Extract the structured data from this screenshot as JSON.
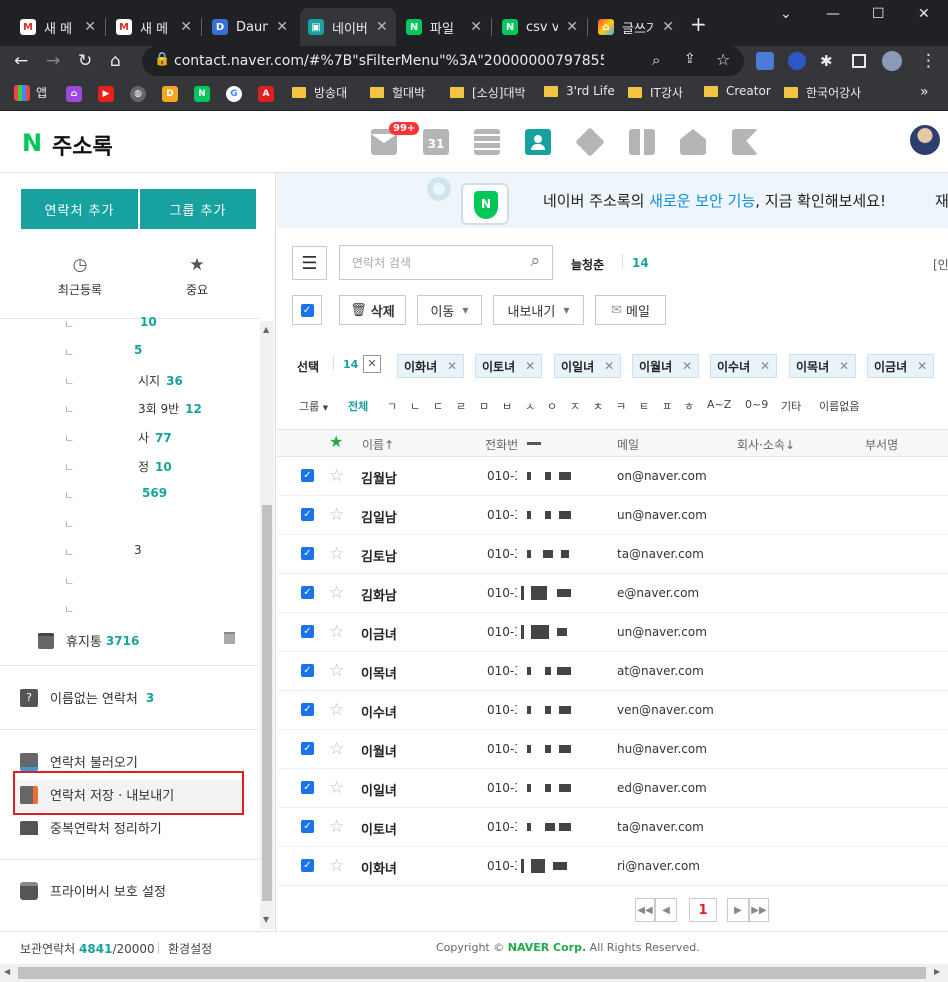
{
  "browser": {
    "tabs": [
      {
        "title": "새 메",
        "icon": "gmail-icon"
      },
      {
        "title": "새 메",
        "icon": "gmail-icon"
      },
      {
        "title": "Daum",
        "icon": "daum-icon"
      },
      {
        "title": "네이버",
        "icon": "naver-contact-icon"
      },
      {
        "title": "파일",
        "icon": "naver-icon"
      },
      {
        "title": "csv vo",
        "icon": "naver-icon"
      },
      {
        "title": "글쓰기",
        "icon": "blog-icon"
      }
    ],
    "url": "contact.naver.com/#%7B\"sFilterMenu\"%3A\"20000000797855\"%2C\"sGr...",
    "bookmarks": [
      "앱",
      "방송대",
      "헐대박",
      "[소싱]대박",
      "3'rd Life",
      "IT강사",
      "Creator",
      "한국어강사"
    ]
  },
  "app": {
    "logo_letter": "N",
    "title": "주소록",
    "mail_badge": "99+",
    "calendar_day": "31",
    "banner_text_pre": "네이버 주소록의 ",
    "banner_text_hl": "새로운 보안 기능",
    "banner_text_post": ", 지금 확인해보세요!",
    "banner_cut": "재"
  },
  "sidebar": {
    "add_contact": "연락처 추가",
    "add_group": "그룹 추가",
    "recent_label": "최근등록",
    "important_label": "중요",
    "tree": [
      {
        "label": "",
        "count": "10"
      },
      {
        "label": "",
        "count": "5"
      },
      {
        "label": "시지",
        "count": "36"
      },
      {
        "label": "3회 9반",
        "count": "12"
      },
      {
        "label": "사",
        "count": "77"
      },
      {
        "label": "정",
        "count": "10"
      },
      {
        "label": "",
        "count": "569"
      },
      {
        "label": "",
        "count": ""
      },
      {
        "label": "3",
        "count": ""
      },
      {
        "label": "",
        "count": ""
      },
      {
        "label": "",
        "count": ""
      }
    ],
    "trash_label": "휴지통",
    "trash_count": "3716",
    "unnamed_label": "이름없는 연락처",
    "unnamed_count": "3",
    "import_label": "연락처 불러오기",
    "export_label": "연락처 저장 · 내보내기",
    "dedupe_label": "중복연락처 정리하기",
    "privacy_label": "프라이버시 보호 설정"
  },
  "main": {
    "search_placeholder": "연락처 검색",
    "group_name": "늘청춘",
    "group_count": "14",
    "right_cut": "[인",
    "delete_label": "삭제",
    "move_label": "이동",
    "export_label": "내보내기",
    "mail_label": "메일",
    "selection_label": "선택",
    "selection_count": "14",
    "chips": [
      "이화녀",
      "이토녀",
      "이일녀",
      "이월녀",
      "이수녀",
      "이목녀",
      "이금녀"
    ],
    "index_group": "그룹",
    "index_all": "전체",
    "index_letters": [
      "ㄱ",
      "ㄴ",
      "ㄷ",
      "ㄹ",
      "ㅁ",
      "ㅂ",
      "ㅅ",
      "ㅇ",
      "ㅈ",
      "ㅊ",
      "ㅋ",
      "ㅌ",
      "ㅍ",
      "ㅎ",
      "A~Z",
      "0~9",
      "기타",
      "이름없음"
    ],
    "col_name": "이름↑",
    "col_phone": "전화번",
    "col_email": "메일",
    "col_company": "회사·소속↓",
    "col_dept": "부서명",
    "rows": [
      {
        "name": "김월남",
        "phone": "010-3",
        "email": "on@naver.com"
      },
      {
        "name": "김일남",
        "phone": "010-3",
        "email": "un@naver.com"
      },
      {
        "name": "김토남",
        "phone": "010-3",
        "email": "ta@naver.com"
      },
      {
        "name": "김화남",
        "phone": "010-3",
        "email": "e@naver.com"
      },
      {
        "name": "이금녀",
        "phone": "010-3",
        "email": "un@naver.com"
      },
      {
        "name": "이목녀",
        "phone": "010-3",
        "email": "at@naver.com"
      },
      {
        "name": "이수녀",
        "phone": "010-3",
        "email": "ven@naver.com"
      },
      {
        "name": "이월녀",
        "phone": "010-3",
        "email": "hu@naver.com"
      },
      {
        "name": "이일녀",
        "phone": "010-3",
        "email": "ed@naver.com"
      },
      {
        "name": "이토녀",
        "phone": "010-3",
        "email": "ta@naver.com"
      },
      {
        "name": "이화녀",
        "phone": "010-3",
        "email": "ri@naver.com"
      }
    ],
    "current_page": "1"
  },
  "footer": {
    "stored_label": "보관연락처",
    "stored_count": "4841",
    "stored_total": "/20000",
    "settings_label": "환경설정",
    "copyright_pre": "Copyright © ",
    "copyright_brand": "NAVER Corp.",
    "copyright_post": " All Rights Reserved."
  },
  "colors": {
    "accent": "#17a2a0",
    "naver_green": "#03c75a",
    "checkbox": "#1a73e8",
    "highlight_box": "#e02020"
  }
}
